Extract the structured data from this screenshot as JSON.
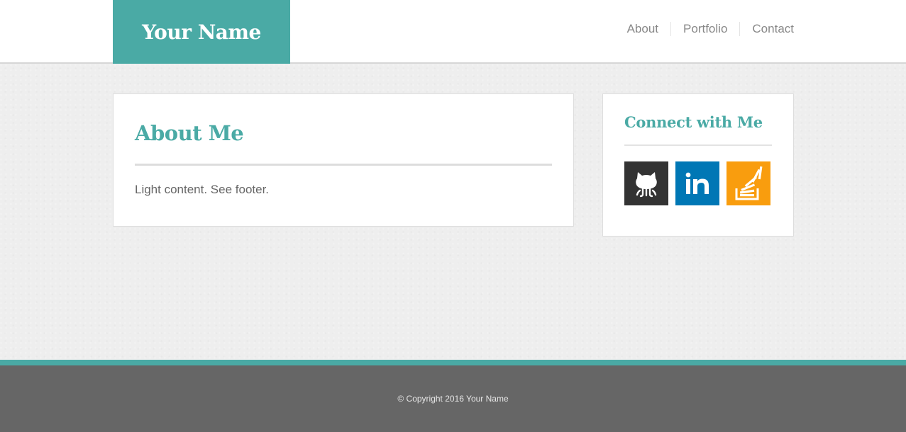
{
  "header": {
    "brand": "Your Name",
    "brand_color": "#4aaaa5",
    "nav": [
      {
        "label": "About"
      },
      {
        "label": "Portfolio"
      },
      {
        "label": "Contact"
      }
    ]
  },
  "about": {
    "title": "About Me",
    "text": "Light content. See footer."
  },
  "connect": {
    "title": "Connect with Me",
    "links": [
      {
        "name": "github",
        "icon": "github-icon",
        "color": "#333333"
      },
      {
        "name": "linkedin",
        "icon": "linkedin-icon",
        "color": "#0077b5"
      },
      {
        "name": "stackoverflow",
        "icon": "stackoverflow-icon",
        "color": "#f99d0e"
      }
    ]
  },
  "footer": {
    "copyright": "© Copyright 2016 Your Name",
    "accent_color": "#4aaaa5",
    "background_color": "#666666"
  }
}
